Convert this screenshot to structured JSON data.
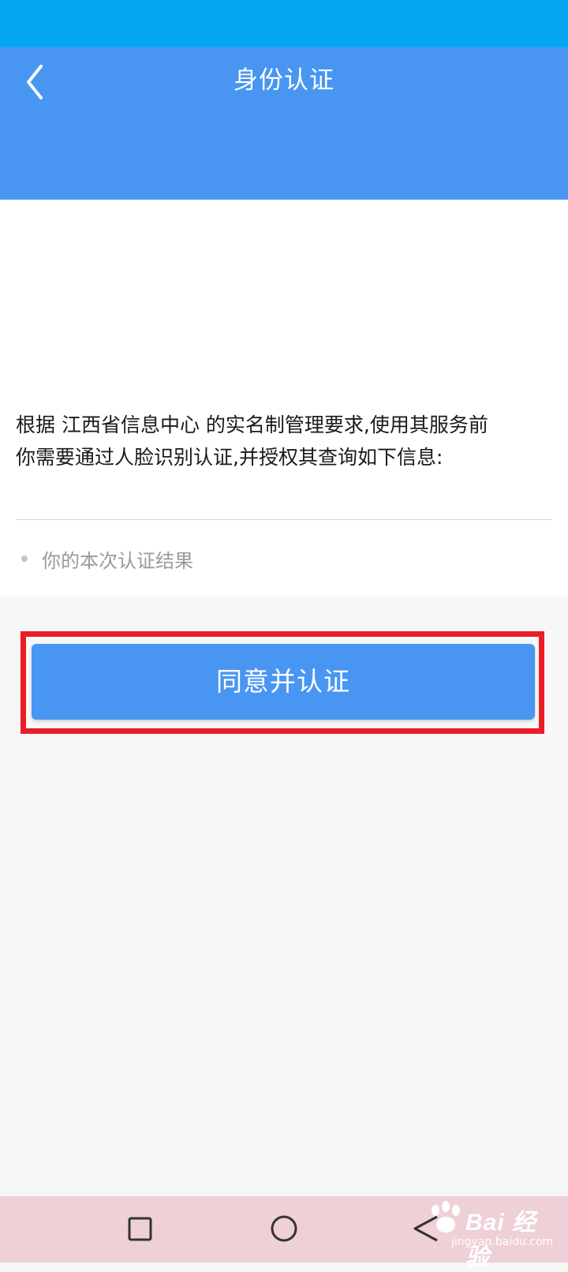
{
  "header": {
    "title": "身份认证",
    "back_icon": "chevron-left-icon",
    "color": "#4896f2",
    "status_bar_color": "#05a6f0"
  },
  "content": {
    "intro": "根据 江西省信息中心 的实名制管理要求,使用其服务前\n你需要通过人脸识别认证,并授权其查询如下信息:",
    "items": [
      {
        "label": "你的本次认证结果"
      }
    ]
  },
  "action": {
    "agree_label": "同意并认证",
    "button_color": "#4896f2",
    "highlight_color": "#ec1c24"
  },
  "nav": {
    "icons": [
      "square-icon",
      "circle-icon",
      "triangle-back-icon"
    ]
  },
  "watermark": {
    "brand": "Bai 经验",
    "url": "jingyan.baidu.com"
  }
}
